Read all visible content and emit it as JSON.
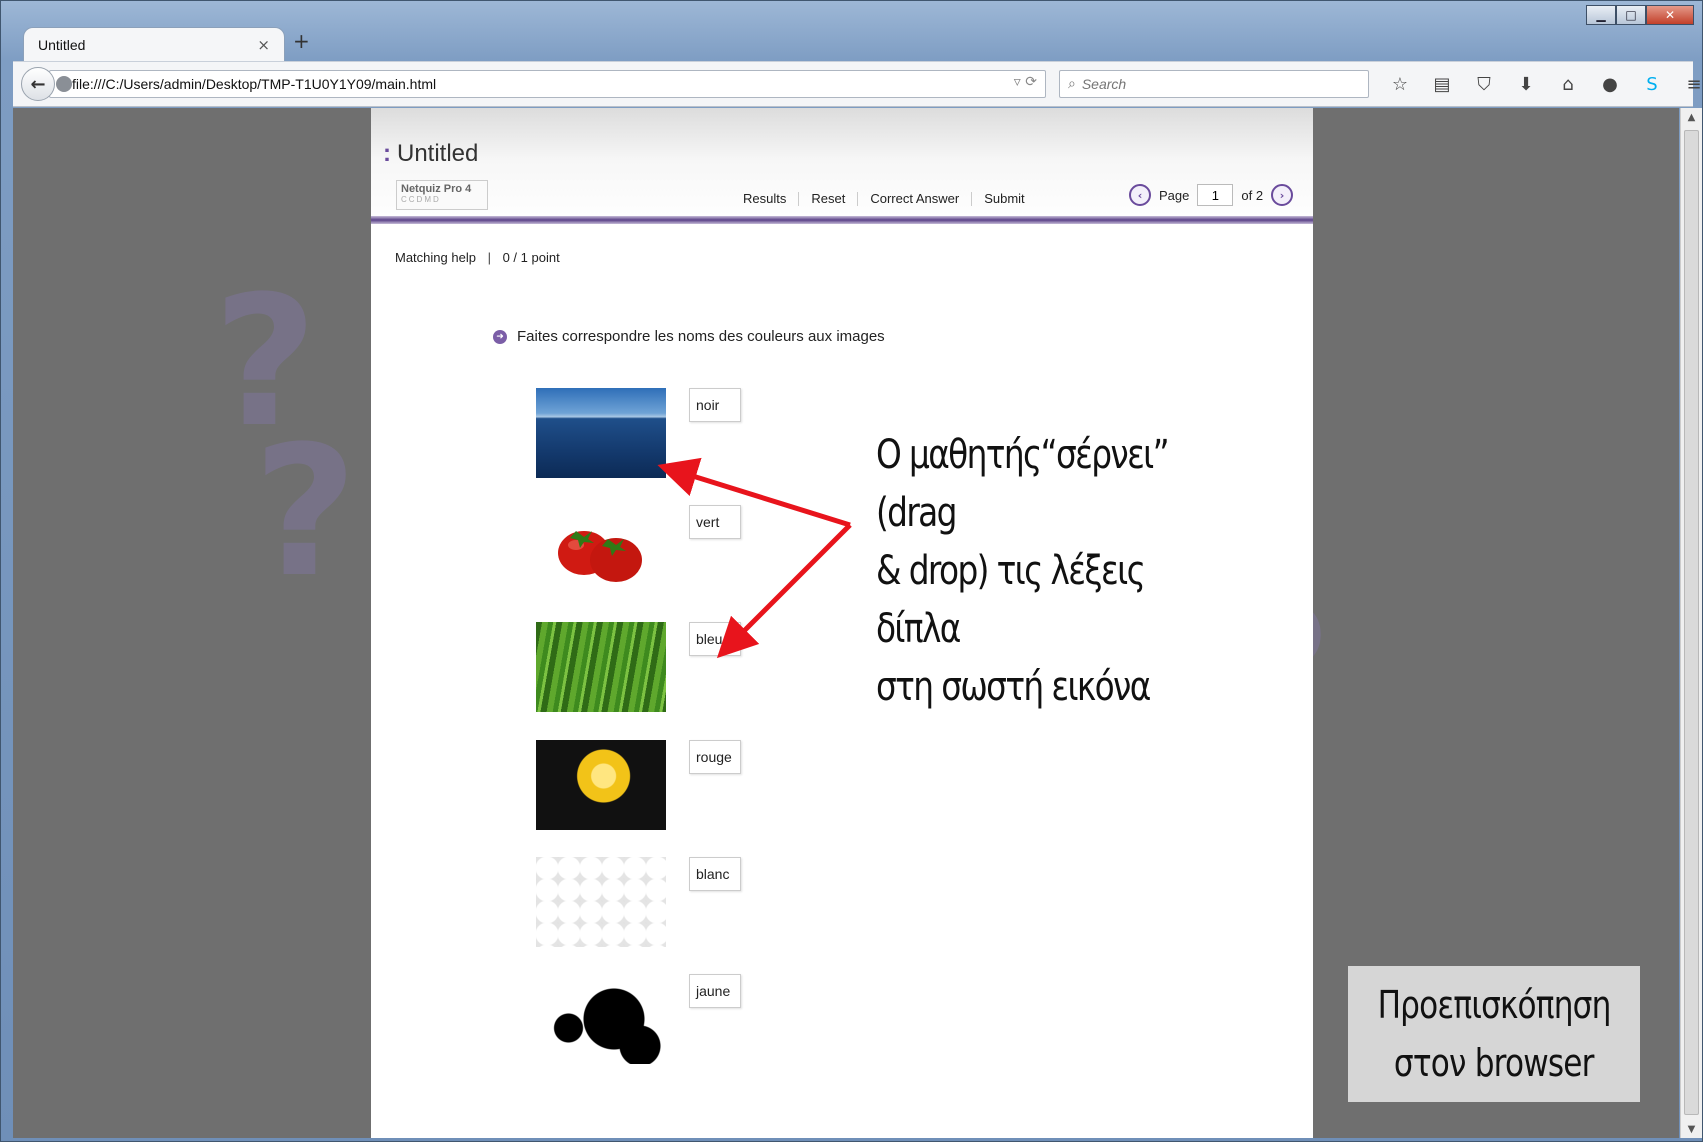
{
  "browser": {
    "tab_title": "Untitled",
    "tab_close": "×",
    "new_tab": "+",
    "url": "file:///C:/Users/admin/Desktop/TMP-T1U0Y1Y09/main.html",
    "search_placeholder": "Search",
    "toolbar_icons": [
      "star-icon",
      "reading-list-icon",
      "pocket-icon",
      "download-icon",
      "home-icon",
      "chat-icon",
      "skype-icon",
      "menu-icon"
    ],
    "window_controls": [
      "minimize",
      "maximize",
      "close"
    ]
  },
  "quiz": {
    "title": "Untitled",
    "logo": {
      "name": "Netquiz Pro 4",
      "sub": "CCDMD"
    },
    "nav": [
      "Results",
      "Reset",
      "Correct Answer",
      "Submit"
    ],
    "pager": {
      "label": "Page",
      "current": "1",
      "of_label": "of 2"
    },
    "status": {
      "type": "Matching help",
      "score": "0 / 1 point"
    },
    "question": "Faites correspondre les noms des couleurs aux images",
    "items": [
      {
        "image": "sea",
        "word": "noir"
      },
      {
        "image": "tomatoes",
        "word": "vert"
      },
      {
        "image": "grass",
        "word": "bleu"
      },
      {
        "image": "yellow-rose",
        "word": "rouge"
      },
      {
        "image": "eggs",
        "word": "blanc"
      },
      {
        "image": "ink-splatter",
        "word": "jaune"
      }
    ]
  },
  "annotation": {
    "lines": [
      "Ο μαθητής“σέρνει” (drag",
      "& drop) τις λέξεις δίπλα",
      "στη σωστή εικόνα"
    ],
    "arrow_color": "#e8141c"
  },
  "preview_label": {
    "lines": [
      "Προεπισκόπηση",
      "στον browser"
    ]
  },
  "colors": {
    "accent": "#6a4b9c",
    "page_bg": "#6f6f6f"
  }
}
